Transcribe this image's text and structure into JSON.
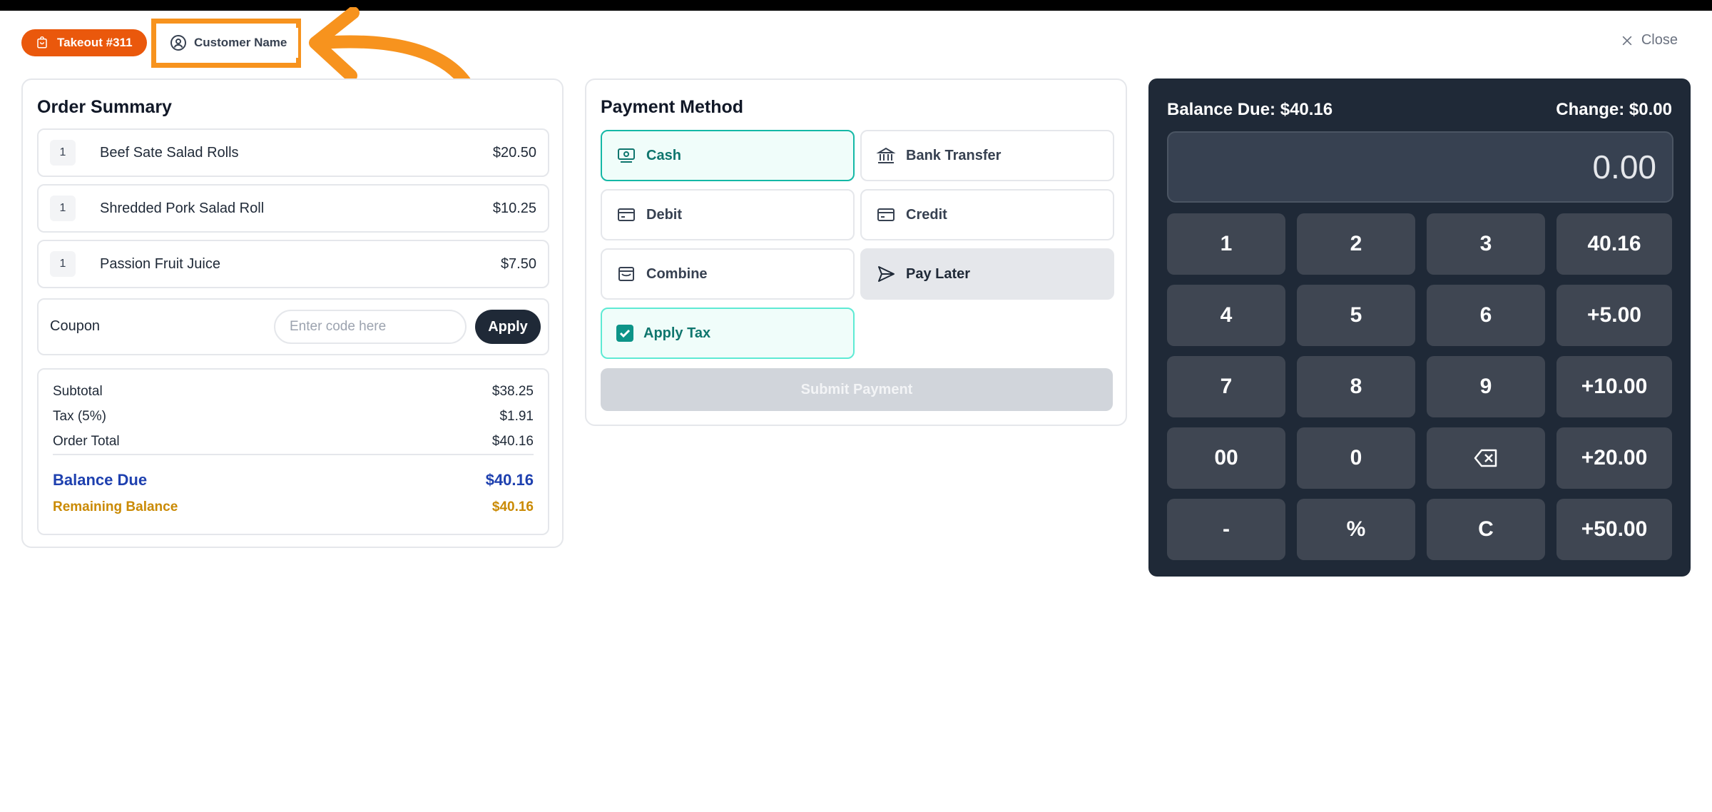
{
  "header": {
    "takeout_label": "Takeout #311",
    "customer_label": "Customer Name",
    "close_label": "Close"
  },
  "order_summary": {
    "title": "Order Summary",
    "items": [
      {
        "qty": "1",
        "name": "Beef Sate Salad Rolls",
        "price": "$20.50"
      },
      {
        "qty": "1",
        "name": "Shredded Pork Salad Roll",
        "price": "$10.25"
      },
      {
        "qty": "1",
        "name": "Passion Fruit Juice",
        "price": "$7.50"
      }
    ],
    "coupon": {
      "label": "Coupon",
      "placeholder": "Enter code here",
      "apply_label": "Apply"
    },
    "totals": {
      "subtotal_label": "Subtotal",
      "subtotal_value": "$38.25",
      "tax_label": "Tax (5%)",
      "tax_value": "$1.91",
      "order_total_label": "Order Total",
      "order_total_value": "$40.16",
      "balance_due_label": "Balance Due",
      "balance_due_value": "$40.16",
      "remaining_label": "Remaining Balance",
      "remaining_value": "$40.16"
    }
  },
  "payment": {
    "title": "Payment Method",
    "methods": {
      "cash": "Cash",
      "bank_transfer": "Bank Transfer",
      "debit": "Debit",
      "credit": "Credit",
      "combine": "Combine",
      "pay_later": "Pay Later"
    },
    "selected_method": "Cash",
    "apply_tax_label": "Apply Tax",
    "apply_tax_checked": true,
    "submit_label": "Submit Payment"
  },
  "keypad": {
    "balance_due": "Balance Due: $40.16",
    "change": "Change: $0.00",
    "display": "0.00",
    "keys": {
      "k1": "1",
      "k2": "2",
      "k3": "3",
      "q1": "40.16",
      "k4": "4",
      "k5": "5",
      "k6": "6",
      "q2": "+5.00",
      "k7": "7",
      "k8": "8",
      "k9": "9",
      "q3": "+10.00",
      "k00": "00",
      "k0": "0",
      "q4": "+20.00",
      "minus": "-",
      "percent": "%",
      "clear": "C",
      "q5": "+50.00"
    }
  },
  "colors": {
    "accent_orange": "#ea580c",
    "highlight_orange": "#f7931e",
    "teal": "#14b8a6",
    "keypad_bg": "#1f2937",
    "balance_blue": "#1e40af",
    "remaining_gold": "#ca8a04"
  }
}
